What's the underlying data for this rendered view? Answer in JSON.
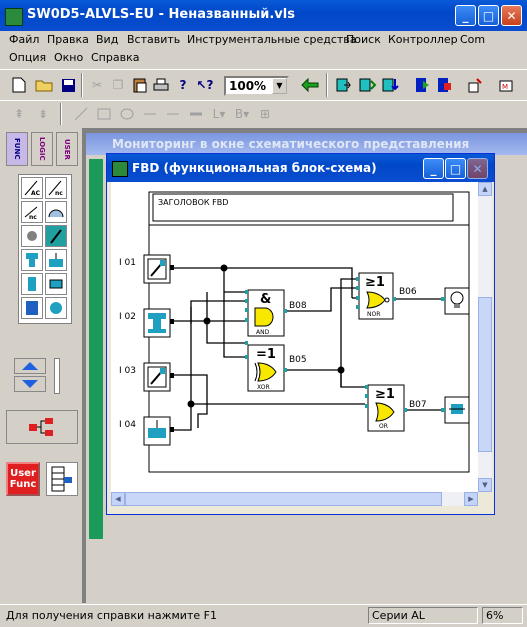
{
  "window": {
    "title": "SW0D5-ALVLS-EU - Неназванный.vls"
  },
  "menu": {
    "row1": [
      "Файл",
      "Правка",
      "Вид",
      "Вставить",
      "Инструментальные средства",
      "Поиск",
      "Контроллер",
      "Com"
    ],
    "row2": [
      "Опция",
      "Окно",
      "Справка"
    ]
  },
  "toolbar": {
    "zoom_value": "100%"
  },
  "palette": {
    "user_func_label_1": "User",
    "user_func_label_2": "Func",
    "tab_labels": [
      "FUNC",
      "LOGIC",
      "USER"
    ]
  },
  "background_window": {
    "title": "Мониторинг в окне схематического представления"
  },
  "fbd_window": {
    "title": "FBD (функциональная блок-схема)",
    "header_label": "ЗАГОЛОВОК FBD",
    "inputs": [
      "I 01",
      "I 02",
      "I 03",
      "I 04"
    ],
    "blocks": [
      {
        "id": "B08",
        "symbol": "&",
        "name": "AND"
      },
      {
        "id": "B05",
        "symbol": "=1",
        "name": "XOR"
      },
      {
        "id": "B06",
        "symbol": "≥1",
        "name": "NOR"
      },
      {
        "id": "B07",
        "symbol": "≥1",
        "name": "OR"
      }
    ]
  },
  "statusbar": {
    "help": "Для получения справки нажмите F1",
    "series": "Серии AL",
    "percent": "6%"
  },
  "colors": {
    "titlebar": "#0a5ad8",
    "gate_yellow": "#f8e800",
    "bg_green": "#1c9a5a"
  }
}
